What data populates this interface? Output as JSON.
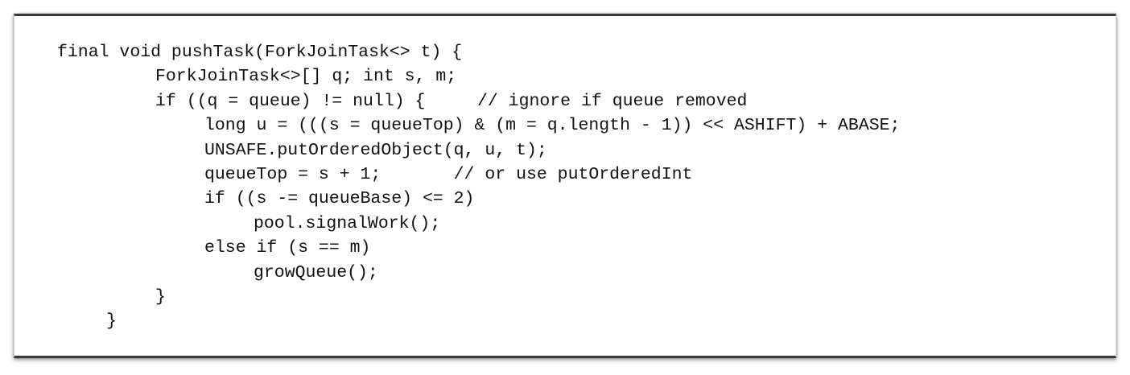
{
  "code_listing": {
    "lines": [
      "final void pushTask(ForkJoinTask<> t) {",
      "ForkJoinTask<>[] q; int s, m;",
      "if ((q = queue) != null) {     // ignore if queue removed",
      "long u = (((s = queueTop) & (m = q.length - 1)) << ASHIFT) + ABASE;",
      "UNSAFE.putOrderedObject(q, u, t);",
      "queueTop = s + 1;       // or use putOrderedInt",
      "if ((s -= queueBase) <= 2)",
      "pool.signalWork();",
      "else if (s == m)",
      "growQueue();",
      "}",
      "}"
    ]
  }
}
